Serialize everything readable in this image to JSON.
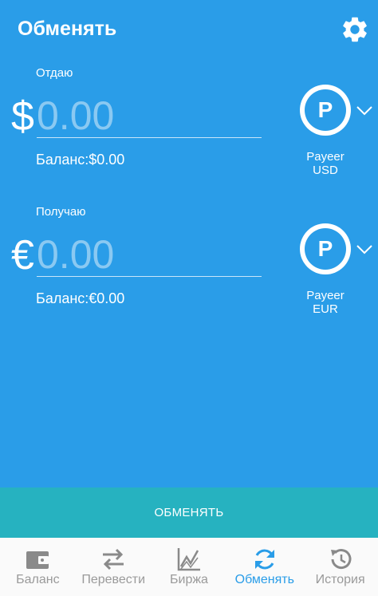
{
  "header": {
    "title": "Обменять"
  },
  "give": {
    "label": "Отдаю",
    "symbol": "$",
    "placeholder": "0.00",
    "balance": "Баланс:$0.00",
    "wallet_letter": "P",
    "wallet_name": "Payeer",
    "wallet_currency": "USD"
  },
  "receive": {
    "label": "Получаю",
    "symbol": "€",
    "placeholder": "0.00",
    "balance": "Баланс:€0.00",
    "wallet_letter": "P",
    "wallet_name": "Payeer",
    "wallet_currency": "EUR"
  },
  "action": {
    "exchange_label": "ОБМЕНЯТЬ"
  },
  "nav": {
    "items": [
      {
        "label": "Баланс",
        "icon": "wallet-icon",
        "active": false
      },
      {
        "label": "Перевести",
        "icon": "transfer-arrows-icon",
        "active": false
      },
      {
        "label": "Биржа",
        "icon": "chart-icon",
        "active": false
      },
      {
        "label": "Обменять",
        "icon": "refresh-icon",
        "active": true
      },
      {
        "label": "История",
        "icon": "history-icon",
        "active": false
      }
    ]
  },
  "colors": {
    "background": "#2a9de8",
    "exchange_button": "#26b2c0",
    "nav_active": "#2a9de8",
    "nav_inactive": "#9a9a9a"
  }
}
